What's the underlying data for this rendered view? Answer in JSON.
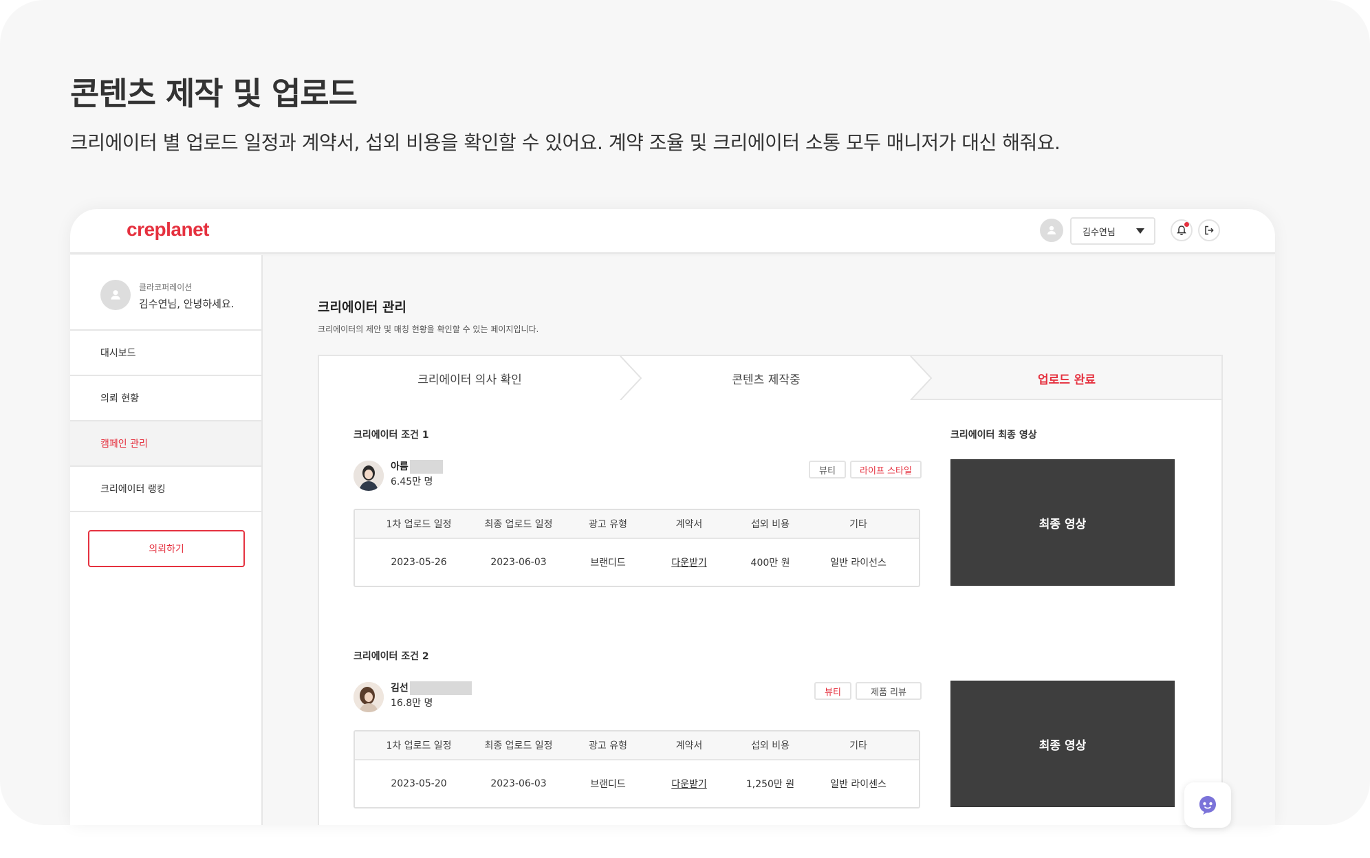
{
  "hero": {
    "title": "콘텐츠 제작 및 업로드",
    "description": "크리에이터 별 업로드 일정과 계약서, 섭외 비용을 확인할 수 있어요. 계약 조율 및 크리에이터 소통 모두 매니저가 대신 해줘요."
  },
  "app": {
    "logo": "creplanet",
    "user_select_value": "김수연님",
    "icons": {
      "avatar": "user-avatar-icon",
      "bell": "bell-icon",
      "logout": "logout-icon",
      "chat": "chatbot-icon"
    },
    "accent_color": "#e5313f"
  },
  "sidebar": {
    "org": "클라코퍼레이션",
    "greeting": "김수연님, 안녕하세요.",
    "items": [
      {
        "label": "대시보드",
        "active": false
      },
      {
        "label": "의뢰 현황",
        "active": false
      },
      {
        "label": "캠페인 관리",
        "active": true
      },
      {
        "label": "크리에이터 랭킹",
        "active": false
      }
    ],
    "request_button": "의뢰하기"
  },
  "main": {
    "title": "크리에이터 관리",
    "description": "크리에이터의 제안 및 매칭 현황을 확인할 수 있는 페이지입니다.",
    "steps": [
      "크리에이터 의사 확인",
      "콘텐츠 제작중",
      "업로드 완료"
    ],
    "columns": [
      "1차 업로드 일정",
      "최종 업로드 일정",
      "광고 유형",
      "계약서",
      "섭외 비용",
      "기타"
    ],
    "video_section_title": "크리에이터 최종 영상",
    "video_label": "최종 영상",
    "creators": [
      {
        "condition_title": "크리에이터 조건 1",
        "name": "아름",
        "followers": "6.45만 명",
        "tags": [
          "뷰티",
          "라이프 스타일"
        ],
        "row": [
          "2023-05-26",
          "2023-06-03",
          "브랜디드",
          "다운받기",
          "400만 원",
          "일반 라이선스"
        ]
      },
      {
        "condition_title": "크리에이터 조건 2",
        "name": "김선",
        "followers": "16.8만 명",
        "tags": [
          "뷰티",
          "제품 리뷰"
        ],
        "row": [
          "2023-05-20",
          "2023-06-03",
          "브랜디드",
          "다운받기",
          "1,250만 원",
          "일반 라이센스"
        ]
      }
    ]
  }
}
